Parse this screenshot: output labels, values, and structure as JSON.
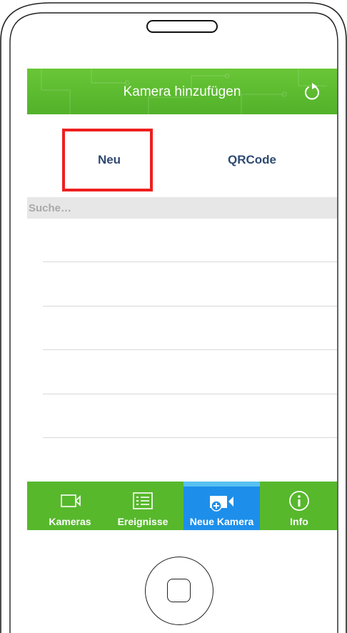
{
  "header": {
    "title": "Kamera hinzufügen"
  },
  "segments": [
    {
      "label": "Neu"
    },
    {
      "label": "QRCode"
    }
  ],
  "search": {
    "placeholder": "Suche…",
    "value": ""
  },
  "tabs": [
    {
      "label": "Kameras",
      "icon": "video-camera-icon"
    },
    {
      "label": "Ereignisse",
      "icon": "list-icon"
    },
    {
      "label": "Neue Kamera",
      "icon": "add-camera-icon",
      "active": true
    },
    {
      "label": "Info",
      "icon": "info-icon"
    }
  ],
  "colors": {
    "brand_green": "#57b82c",
    "active_tab": "#1d8fea",
    "highlight": "#ef1f1f",
    "segment_text": "#2f4a73"
  }
}
